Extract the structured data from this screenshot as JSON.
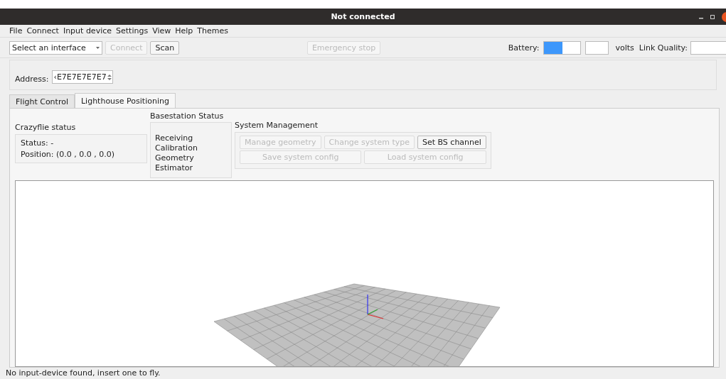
{
  "window": {
    "title": "Not connected"
  },
  "menu": [
    "File",
    "Connect",
    "Input device",
    "Settings",
    "View",
    "Help",
    "Themes"
  ],
  "toolbar": {
    "interface_select": "Select an interface",
    "buttons": [
      {
        "label": "Connect",
        "disabled": true
      },
      {
        "label": "Scan",
        "disabled": false
      }
    ],
    "emergency_stop": {
      "label": "Emergency stop",
      "disabled": true
    },
    "battery_label": "Battery:",
    "battery": {
      "level": 0.5
    },
    "volts_unit": "volts",
    "link_quality_label": "Link Quality:"
  },
  "address": {
    "label": "Address:",
    "value": "‹E7E7E7E7E7"
  },
  "tabs": [
    {
      "label": "Flight Control",
      "selected": false
    },
    {
      "label": "Lighthouse Positioning",
      "selected": true
    }
  ],
  "crazyflie_status": {
    "title": "Crazyflie status",
    "lines": [
      "Status: -",
      "Position: (0.0 , 0.0 , 0.0)"
    ]
  },
  "basestation_status": {
    "title": "Basestation Status",
    "lines": [
      "Receiving",
      "Calibration",
      "Geometry",
      "Estimator"
    ]
  },
  "system_management": {
    "title": "System Management",
    "buttons": [
      {
        "label": "Manage geometry",
        "disabled": true
      },
      {
        "label": "Change system type",
        "disabled": true
      },
      {
        "label": "Set BS channel",
        "disabled": false
      },
      {
        "label": "Save system config",
        "disabled": true
      },
      {
        "label": "Load system config",
        "disabled": true
      }
    ]
  },
  "status_bar": "No input-device found, insert one to fly."
}
